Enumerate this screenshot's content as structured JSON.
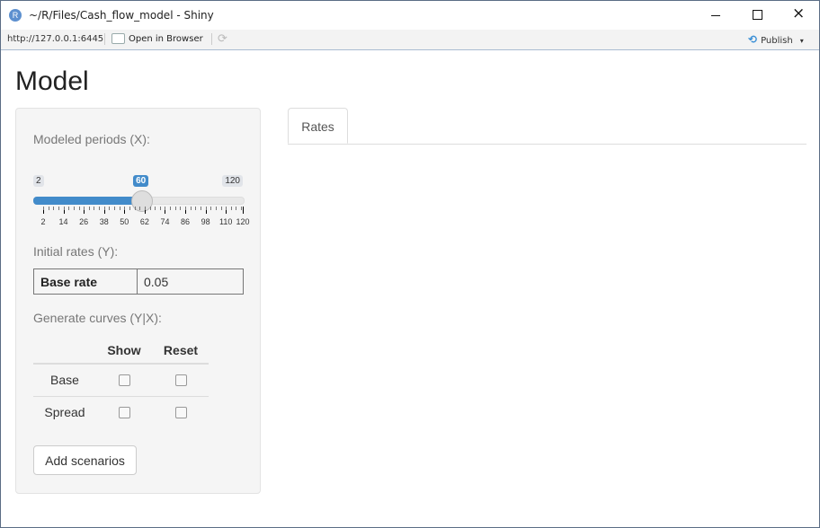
{
  "window": {
    "title": "~/R/Files/Cash_flow_model - Shiny",
    "app_icon": "R",
    "minimize_icon": "minimize-icon",
    "maximize_icon": "maximize-icon",
    "close_icon": "×"
  },
  "toolbar": {
    "url": "http://127.0.0.1:6445",
    "open_in_browser": "Open in Browser",
    "refresh_icon": "⟳",
    "publish": "Publish",
    "publish_icon": "⟲",
    "caret": "▾"
  },
  "page": {
    "title": "Model"
  },
  "sidebar": {
    "periods_label": "Modeled periods (X):",
    "slider": {
      "min": 2,
      "max": 120,
      "value": 60,
      "min_label": "2",
      "max_label": "120",
      "value_label": "60",
      "tick_labels": [
        "2",
        "14",
        "26",
        "38",
        "50",
        "62",
        "74",
        "86",
        "98",
        "110",
        "120"
      ]
    },
    "rates_label": "Initial rates (Y):",
    "rate_table": {
      "key": "Base rate",
      "value": "0.05"
    },
    "curves_label": "Generate curves (Y|X):",
    "curves_table": {
      "headers": [
        "",
        "Show",
        "Reset"
      ],
      "rows": [
        {
          "label": "Base",
          "show": false,
          "reset": false
        },
        {
          "label": "Spread",
          "show": false,
          "reset": false
        }
      ]
    },
    "add_button": "Add scenarios"
  },
  "main": {
    "tabs": [
      {
        "label": "Rates",
        "active": true
      }
    ]
  }
}
